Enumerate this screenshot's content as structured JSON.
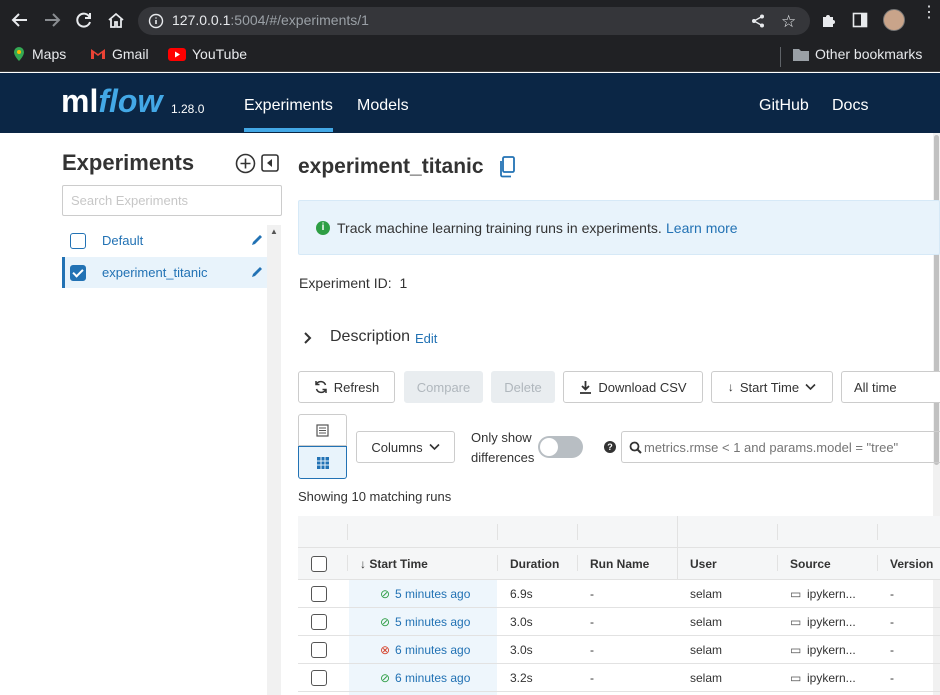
{
  "browser": {
    "url_host": "127.0.0.1",
    "url_rest": ":5004/#/experiments/1",
    "bookmarks": [
      {
        "label": "Maps",
        "icon": "maps-pin-icon"
      },
      {
        "label": "Gmail",
        "icon": "gmail-icon"
      },
      {
        "label": "YouTube",
        "icon": "youtube-icon"
      }
    ],
    "other_bookmarks": "Other bookmarks"
  },
  "header": {
    "logo_ml": "ml",
    "logo_flow": "flow",
    "version": "1.28.0",
    "nav_experiments": "Experiments",
    "nav_models": "Models",
    "nav_github": "GitHub",
    "nav_docs": "Docs"
  },
  "sidebar": {
    "title": "Experiments",
    "search_placeholder": "Search Experiments",
    "items": [
      {
        "label": "Default",
        "checked": false
      },
      {
        "label": "experiment_titanic",
        "checked": true
      }
    ]
  },
  "main": {
    "title": "experiment_titanic",
    "banner_text": "Track machine learning training runs in experiments.",
    "banner_link": "Learn more",
    "experiment_id_label": "Experiment ID:",
    "experiment_id": "1",
    "description_label": "Description",
    "edit_label": "Edit",
    "buttons": {
      "refresh": "Refresh",
      "compare": "Compare",
      "delete": "Delete",
      "download_csv": "Download CSV",
      "sort": "Start Time",
      "time_range": "All time",
      "columns": "Columns"
    },
    "only_show_differences": [
      "Only show",
      "differences"
    ],
    "search_placeholder": "metrics.rmse < 1 and params.model = \"tree\"",
    "showing_text": "Showing 10 matching runs"
  },
  "table": {
    "headers": [
      "Start Time",
      "Duration",
      "Run Name",
      "User",
      "Source",
      "Version"
    ],
    "rows": [
      {
        "status": "success",
        "start": "5 minutes ago",
        "duration": "6.9s",
        "run_name": "-",
        "user": "selam",
        "source": "ipykern...",
        "version": "-"
      },
      {
        "status": "success",
        "start": "5 minutes ago",
        "duration": "3.0s",
        "run_name": "-",
        "user": "selam",
        "source": "ipykern...",
        "version": "-"
      },
      {
        "status": "failed",
        "start": "6 minutes ago",
        "duration": "3.0s",
        "run_name": "-",
        "user": "selam",
        "source": "ipykern...",
        "version": "-"
      },
      {
        "status": "success",
        "start": "6 minutes ago",
        "duration": "3.2s",
        "run_name": "-",
        "user": "selam",
        "source": "ipykern...",
        "version": "-"
      }
    ]
  },
  "colors": {
    "header_bg": "#0b2645",
    "accent": "#2272b4",
    "logo_flow": "#43a8e6",
    "success": "#2e9e44",
    "failed": "#d5422b"
  }
}
